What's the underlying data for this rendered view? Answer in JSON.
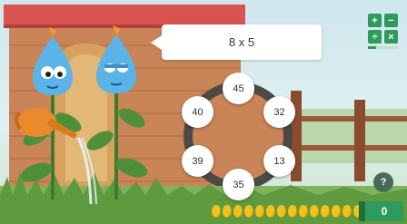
{
  "question": {
    "text": "8 x 5"
  },
  "answers": [
    "45",
    "32",
    "13",
    "35",
    "39",
    "40"
  ],
  "operations": [
    "+",
    "−",
    "÷",
    "×"
  ],
  "progress": 0.25,
  "help_label": "?",
  "score": "0",
  "coins_count": 17,
  "colors": {
    "accent": "#2e9b5d",
    "coin": "#f1c21b",
    "roof": "#d9534f"
  },
  "icons": [
    "plus-icon",
    "minus-icon",
    "divide-icon",
    "times-icon",
    "help-icon",
    "coin-icon",
    "watering-can-icon"
  ]
}
